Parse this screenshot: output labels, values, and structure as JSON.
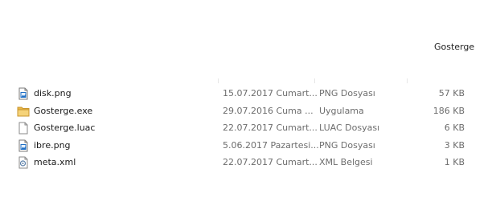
{
  "header": {
    "title": "Gosterge"
  },
  "files": [
    {
      "name": "disk.png",
      "date": "15.07.2017 Cumart...",
      "type": "PNG Dosyası",
      "size": "57 KB",
      "icon": "png-image-icon"
    },
    {
      "name": "Gosterge.exe",
      "date": "29.07.2016 Cuma ...",
      "type": "Uygulama",
      "size": "186 KB",
      "icon": "folder-icon"
    },
    {
      "name": "Gosterge.luac",
      "date": "22.07.2017 Cumart...",
      "type": "LUAC Dosyası",
      "size": "6 KB",
      "icon": "blank-file-icon"
    },
    {
      "name": "ibre.png",
      "date": "5.06.2017 Pazartesi...",
      "type": "PNG Dosyası",
      "size": "3 KB",
      "icon": "png-image-icon"
    },
    {
      "name": "meta.xml",
      "date": "22.07.2017 Cumart...",
      "type": "XML Belgesi",
      "size": "1 KB",
      "icon": "xml-file-icon"
    }
  ]
}
